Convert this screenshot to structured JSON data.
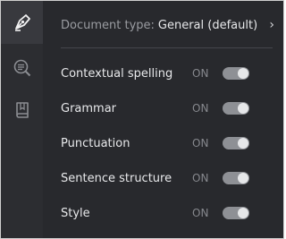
{
  "rail": {
    "items": [
      {
        "icon": "pen-nib-icon",
        "active": true
      },
      {
        "icon": "search-document-icon",
        "active": false
      },
      {
        "icon": "book-icon",
        "active": false
      }
    ]
  },
  "document_type": {
    "label": "Document type:",
    "value": "General (default)",
    "chevron": "›"
  },
  "settings": [
    {
      "name": "Contextual spelling",
      "state": "ON",
      "enabled": true
    },
    {
      "name": "Grammar",
      "state": "ON",
      "enabled": true
    },
    {
      "name": "Punctuation",
      "state": "ON",
      "enabled": true
    },
    {
      "name": "Sentence structure",
      "state": "ON",
      "enabled": true
    },
    {
      "name": "Style",
      "state": "ON",
      "enabled": true
    }
  ],
  "colors": {
    "background": "#28292d",
    "rail": "#2c2d31",
    "toggle_track": "#8e9095",
    "toggle_knob": "#e6e7e9"
  }
}
